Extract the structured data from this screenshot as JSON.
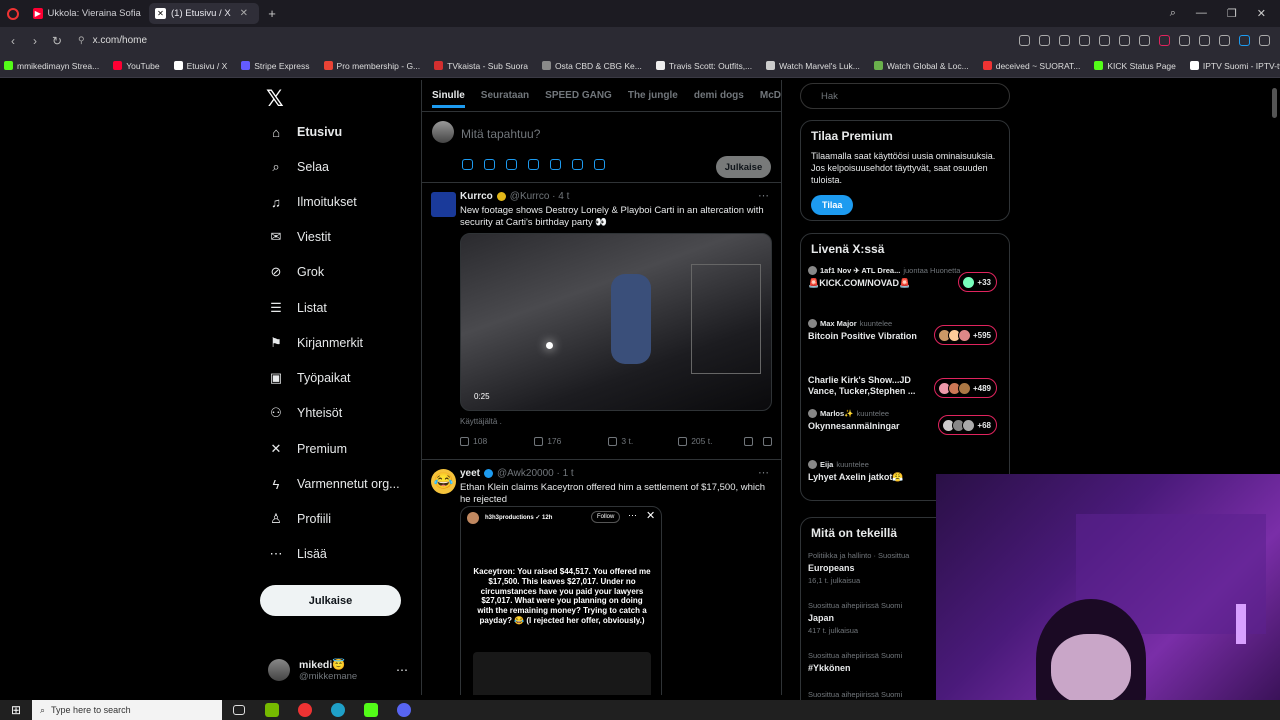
{
  "browser": {
    "tabs": [
      {
        "title": "Ukkola: Vieraina Sofia Virt",
        "favicon_color": "#ff0033",
        "active": false
      },
      {
        "title": "(1) Etusivu / X",
        "favicon_color": "#000000",
        "active": true
      }
    ],
    "url": "x.com/home",
    "bookmarks": [
      {
        "label": "mmikedimayn Strea...",
        "color": "#53fc18"
      },
      {
        "label": "YouTube",
        "color": "#ff0033"
      },
      {
        "label": "Etusivu / X",
        "color": "#ffffff"
      },
      {
        "label": "Stripe Express",
        "color": "#635bff"
      },
      {
        "label": "Pro membership - G...",
        "color": "#ea4335"
      },
      {
        "label": "TVkaista - Sub Suora",
        "color": "#d32f2f"
      },
      {
        "label": "Osta CBD & CBG Ke...",
        "color": "#8a8a8a"
      },
      {
        "label": "Travis Scott: Outfits,...",
        "color": "#eeeeee"
      },
      {
        "label": "Watch Marvel's Luk...",
        "color": "#cccccc"
      },
      {
        "label": "Watch Global & Loc...",
        "color": "#6ab04c"
      },
      {
        "label": "deceived ~ SUORAT...",
        "color": "#e33"
      },
      {
        "label": "KICK Status Page",
        "color": "#53fc18"
      },
      {
        "label": "IPTV Suomi - IPTV-tv...",
        "color": "#ffffff"
      }
    ]
  },
  "nav": {
    "items": [
      {
        "label": "Etusivu",
        "icon": "home-icon",
        "glyph": "⌂"
      },
      {
        "label": "Selaa",
        "icon": "search-icon",
        "glyph": "⌕"
      },
      {
        "label": "Ilmoitukset",
        "icon": "bell-icon",
        "glyph": "♫"
      },
      {
        "label": "Viestit",
        "icon": "mail-icon",
        "glyph": "✉"
      },
      {
        "label": "Grok",
        "icon": "grok-icon",
        "glyph": "⊘"
      },
      {
        "label": "Listat",
        "icon": "list-icon",
        "glyph": "☰"
      },
      {
        "label": "Kirjanmerkit",
        "icon": "bookmark-icon",
        "glyph": "⚑"
      },
      {
        "label": "Työpaikat",
        "icon": "briefcase-icon",
        "glyph": "▣"
      },
      {
        "label": "Yhteisöt",
        "icon": "communities-icon",
        "glyph": "⚇"
      },
      {
        "label": "Premium",
        "icon": "x-icon",
        "glyph": "✕"
      },
      {
        "label": "Varmennetut org...",
        "icon": "lightning-icon",
        "glyph": "ϟ"
      },
      {
        "label": "Profiili",
        "icon": "person-icon",
        "glyph": "♙"
      },
      {
        "label": "Lisää",
        "icon": "more-icon",
        "glyph": "⋯"
      }
    ],
    "post_label": "Julkaise",
    "profile": {
      "name": "mikedi😇",
      "handle": "@mikkemane"
    }
  },
  "feed": {
    "tabs": [
      "Sinulle",
      "Seurataan",
      "SPEED GANG",
      "The jungle",
      "demi dogs",
      "McDonal"
    ],
    "compose_placeholder": "Mitä tapahtuu?",
    "compose_button": "Julkaise",
    "tweets": [
      {
        "name": "Kurrco",
        "handle": "@Kurrco · 4 t",
        "text": "New footage shows Destroy Lonely & Playboi Carti in an altercation with security at Carti's birthday party 👀",
        "video_time": "0:25",
        "caption": "Käyttäjältä .",
        "replies": "108",
        "reposts": "176",
        "likes": "3 t.",
        "views": "205 t."
      },
      {
        "name": "yeet",
        "handle": "@Awk20000 · 1 t",
        "text": "Ethan Klein claims Kaceytron offered him a settlement of $17,500, which he rejected",
        "embed_user": "h3h3productions ✓ 12h",
        "embed_follow": "Follow",
        "embed_text": "Kaceytron: You raised $44,517. You offered me $17,500. This leaves $27,017. Under no circumstances have you paid your lawyers $27,017. What were you planning on doing with the remaining money? Trying to catch a payday? 😂 (I rejected her offer, obviously.)"
      }
    ]
  },
  "right": {
    "search_placeholder": "Hak",
    "premium": {
      "title": "Tilaa Premium",
      "text": "Tilaamalla saat käyttöösi uusia ominaisuuksia. Jos kelpoisuusehdot täyttyvät, saat osuuden tuloista.",
      "button": "Tilaa"
    },
    "live": {
      "title": "Livenä X:ssä",
      "items": [
        {
          "host": "1af1 Nov ✈ ATL Drea...",
          "role": "juontaa Huonetta",
          "title": "🚨KICK.COM/NOVAD🚨",
          "count": "+33"
        },
        {
          "host": "Max Major",
          "role": "kuuntelee",
          "title": "Bitcoin Positive Vibration",
          "count": "+595"
        },
        {
          "host": "",
          "role": "",
          "title": "Charlie Kirk's Show...JD Vance, Tucker,Stephen ...",
          "count": "+489"
        },
        {
          "host": "Marlos✨",
          "role": "kuuntelee",
          "title": "Okynnesanmälningar",
          "count": "+68"
        },
        {
          "host": "Eija",
          "role": "kuuntelee",
          "title": "Lyhyet Axelin jatkot😤",
          "count": ""
        }
      ]
    },
    "trends": {
      "title": "Mitä on tekeillä",
      "items": [
        {
          "category": "Politiikka ja hallinto · Suosittua",
          "name": "Europeans",
          "posts": "16,1 t. julkaisua"
        },
        {
          "category": "Suosittua aihepiirissä Suomi",
          "name": "Japan",
          "posts": "417 t. julkaisua"
        },
        {
          "category": "Suosittua aihepiirissä Suomi",
          "name": "#Ykkönen",
          "posts": ""
        },
        {
          "category": "Suosittua aihepiirissä Suomi",
          "name": "",
          "posts": ""
        }
      ]
    }
  },
  "taskbar": {
    "search_placeholder": "Type here to search"
  },
  "colors": {
    "accent": "#1d9bf0",
    "bg": "#000000",
    "border": "#2f3336",
    "verified_gold": "#e2b719"
  }
}
